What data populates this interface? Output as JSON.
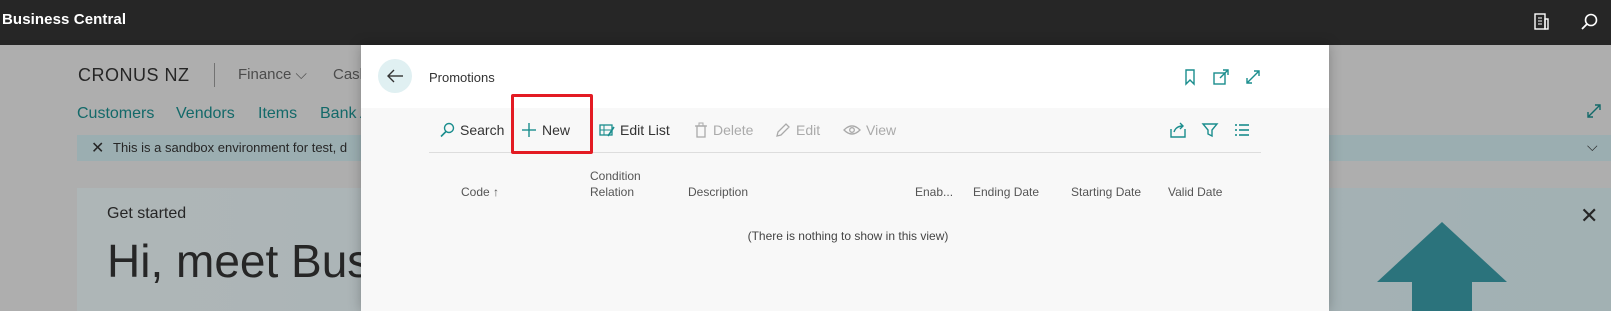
{
  "topbar": {
    "brand": "Business Central",
    "icons": [
      "report-icon",
      "search-icon"
    ]
  },
  "background": {
    "company": "CRONUS NZ",
    "menu": [
      "Finance",
      "Cash"
    ],
    "nav": [
      "Customers",
      "Vendors",
      "Items",
      "Bank A"
    ],
    "notice": "This is a sandbox environment for test, d",
    "card": {
      "eyebrow": "Get started",
      "headline": "Hi, meet Bus"
    }
  },
  "dialog": {
    "title": "Promotions",
    "actions": {
      "search": "Search",
      "new": "New",
      "edit_list": "Edit List",
      "delete": "Delete",
      "edit": "Edit",
      "view": "View"
    },
    "columns": {
      "code": "Code ↑",
      "condition_relation_1": "Condition",
      "condition_relation_2": "Relation",
      "description": "Description",
      "enabled": "Enab...",
      "ending_date": "Ending Date",
      "starting_date": "Starting Date",
      "valid_date": "Valid Date"
    },
    "empty_message": "(There is nothing to show in this view)"
  },
  "colors": {
    "accent": "#1a8d8d",
    "highlight": "#e31b23",
    "topbar": "#262626"
  }
}
